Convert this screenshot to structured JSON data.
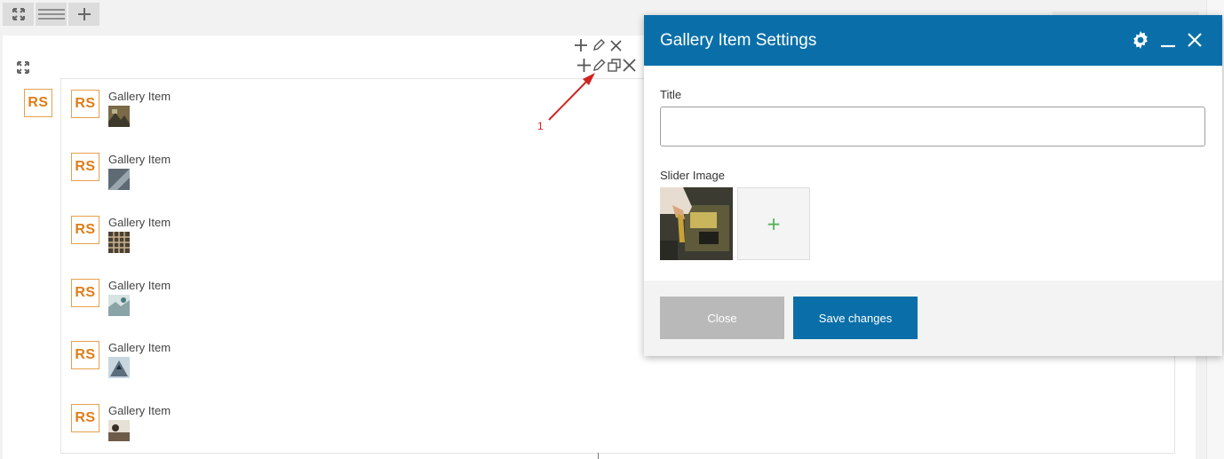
{
  "toolbar": {
    "icons": [
      "expand-icon",
      "menu-icon",
      "plus-icon"
    ]
  },
  "row": {
    "logo": "RS"
  },
  "gallery": {
    "items": [
      {
        "label": "Gallery Item",
        "logo": "RS",
        "thumb_color": "#7a6a48"
      },
      {
        "label": "Gallery Item",
        "logo": "RS",
        "thumb_color": "#5e6a74"
      },
      {
        "label": "Gallery Item",
        "logo": "RS",
        "thumb_color": "#4b4034"
      },
      {
        "label": "Gallery Item",
        "logo": "RS",
        "thumb_color": "#8aa3a6"
      },
      {
        "label": "Gallery Item",
        "logo": "RS",
        "thumb_color": "#5a6e7e"
      },
      {
        "label": "Gallery Item",
        "logo": "RS",
        "thumb_color": "#6d5c4a"
      }
    ]
  },
  "annotation": {
    "number": "1"
  },
  "modal": {
    "title": "Gallery Item Settings",
    "title_label": "Title",
    "title_value": "",
    "slider_image_label": "Slider Image",
    "add_symbol": "+",
    "close_label": "Close",
    "save_label": "Save changes"
  },
  "colors": {
    "header": "#0a6fa9",
    "accent_orange": "#e07c15",
    "annotation_red": "#d22222",
    "add_green": "#4caf50"
  }
}
